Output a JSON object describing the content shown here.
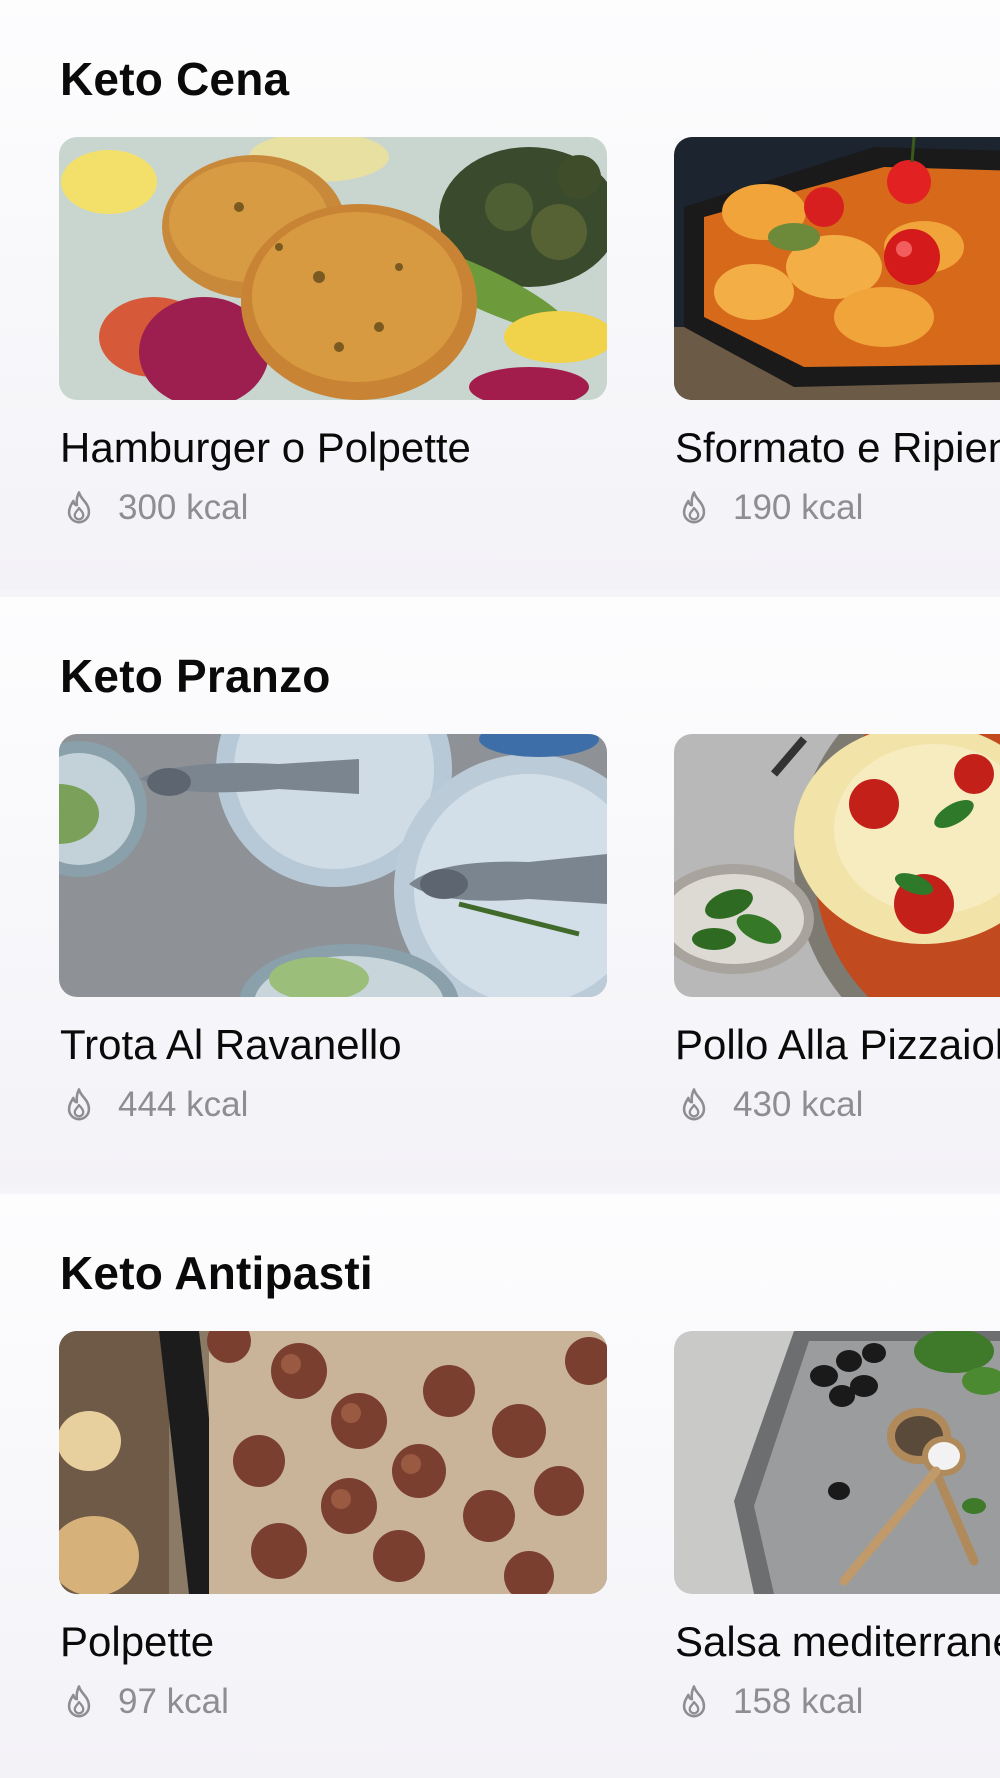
{
  "sections": [
    {
      "title": "Keto Cena",
      "cards": [
        {
          "title": "Hamburger o Polpette",
          "kcal": "300 kcal",
          "image": "breaded-patties-salad-photo"
        },
        {
          "title": "Sformato e Ripieni",
          "kcal": "190 kcal",
          "image": "potato-stew-cherry-tomatoes-photo"
        }
      ]
    },
    {
      "title": "Keto Pranzo",
      "cards": [
        {
          "title": "Trota Al Ravanello",
          "kcal": "444 kcal",
          "image": "trout-plates-photo"
        },
        {
          "title": "Pollo Alla Pizzaiola",
          "kcal": "430 kcal",
          "image": "pizzaiola-chicken-pan-photo"
        }
      ]
    },
    {
      "title": "Keto Antipasti",
      "cards": [
        {
          "title": "Polpette",
          "kcal": "97 kcal",
          "image": "meatballs-tray-photo"
        },
        {
          "title": "Salsa mediterranea",
          "kcal": "158 kcal",
          "image": "olives-spices-tray-photo"
        }
      ]
    }
  ],
  "icons": {
    "calories": "flame-icon"
  },
  "colors": {
    "muted_text": "#8d8d92",
    "background": "#f5f4f9"
  }
}
